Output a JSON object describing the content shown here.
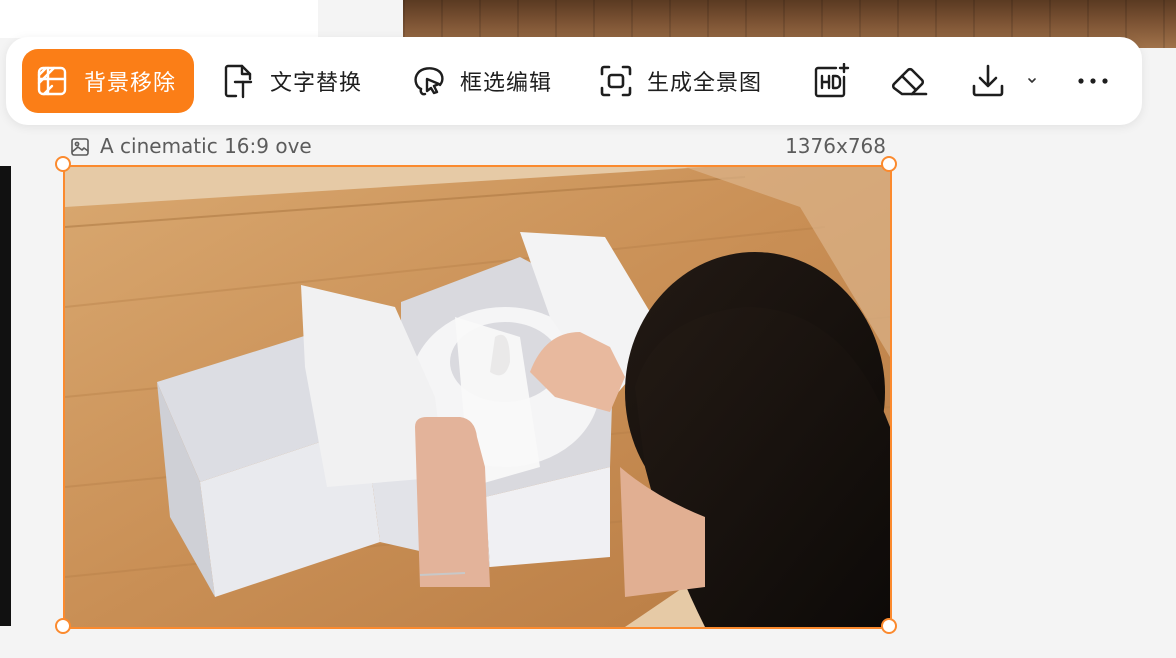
{
  "toolbar": {
    "items": [
      {
        "label": "背景移除",
        "icon": "background-remove-icon",
        "active": true
      },
      {
        "label": "文字替换",
        "icon": "text-replace-icon"
      },
      {
        "label": "框选编辑",
        "icon": "lasso-edit-icon"
      },
      {
        "label": "生成全景图",
        "icon": "panorama-icon"
      }
    ],
    "icon_buttons": [
      "hd-upscale-icon",
      "eraser-icon",
      "download-icon",
      "chevron-down-icon",
      "more-icon"
    ]
  },
  "image": {
    "title": "A cinematic 16:9 ove",
    "dimensions": "1376x768",
    "icon": "image-icon"
  },
  "colors": {
    "accent": "#fb7e17",
    "selection_border": "#fb8a2e",
    "background": "#f4f4f4"
  }
}
